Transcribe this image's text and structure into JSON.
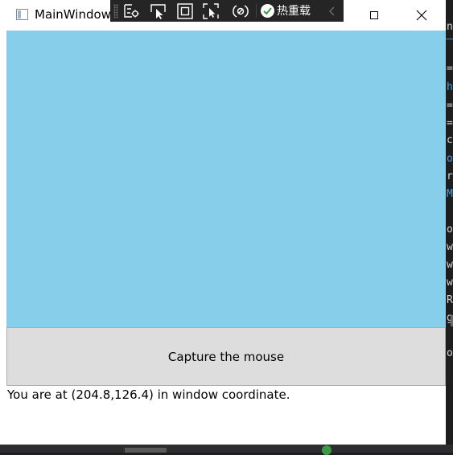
{
  "window": {
    "title": "MainWindow",
    "maximize_icon": "maximize-icon",
    "close_icon": "close-icon"
  },
  "hot_reload_toolbar": {
    "tools": [
      {
        "icon": "live-visual-tree-icon"
      },
      {
        "icon": "select-element-icon"
      },
      {
        "icon": "display-layout-adorners-icon"
      },
      {
        "icon": "track-focused-element-icon"
      },
      {
        "icon": "binding-failures-icon"
      }
    ],
    "status_icon": "check-circle-icon",
    "status_label": "热重载",
    "collapse_icon": "chevron-left-icon",
    "status_color": "#3c9a44"
  },
  "canvas": {
    "color": "#87ceeb"
  },
  "capture_button": {
    "label": "Capture the mouse"
  },
  "coordinates": {
    "text": "You are at (204.8,126.4) in window coordinate."
  }
}
